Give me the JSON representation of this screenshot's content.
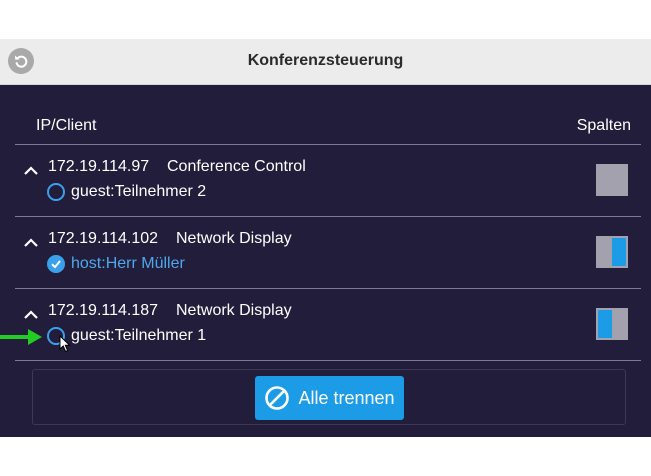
{
  "header": {
    "title": "Konferenzsteuerung",
    "back_icon": "undo-icon"
  },
  "columns": {
    "client": "IP/Client",
    "layout": "Spalten"
  },
  "rows": [
    {
      "ip": "172.19.114.97",
      "type": "Conference Control",
      "user": "guest:Teilnehmer 2",
      "selected": false,
      "layout": "full"
    },
    {
      "ip": "172.19.114.102",
      "type": "Network Display",
      "user": "host:Herr Müller",
      "selected": true,
      "layout": "right"
    },
    {
      "ip": "172.19.114.187",
      "type": "Network Display",
      "user": "guest:Teilnehmer 1",
      "selected": false,
      "layout": "left"
    }
  ],
  "footer": {
    "disconnect_all_label": "Alle trennen",
    "disconnect_icon": "ban-icon"
  },
  "colors": {
    "background": "#211d3a",
    "accent": "#1c9be6",
    "header": "#ececec",
    "layout_inactive": "#a2a1ad",
    "pointer_arrow": "#22cc22"
  }
}
